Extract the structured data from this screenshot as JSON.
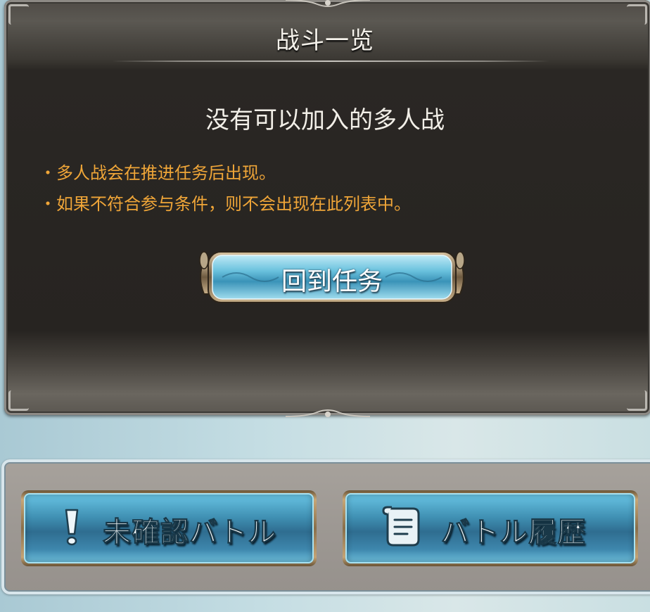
{
  "dialog": {
    "title": "战斗一览",
    "heading": "没有可以加入的多人战",
    "notes": [
      "・多人战会在推进任务后出现。",
      "・如果不符合参与条件，则不会出现在此列表中。"
    ],
    "return_button_label": "回到任务"
  },
  "bottom_bar": {
    "unconfirmed_label": "未確認バトル",
    "unconfirmed_icon": "exclamation-icon",
    "history_label": "バトル履歴",
    "history_icon": "scroll-icon"
  },
  "colors": {
    "note_text": "#f0a638",
    "button_blue": "#3f8fb2",
    "panel_dark": "#272421"
  }
}
